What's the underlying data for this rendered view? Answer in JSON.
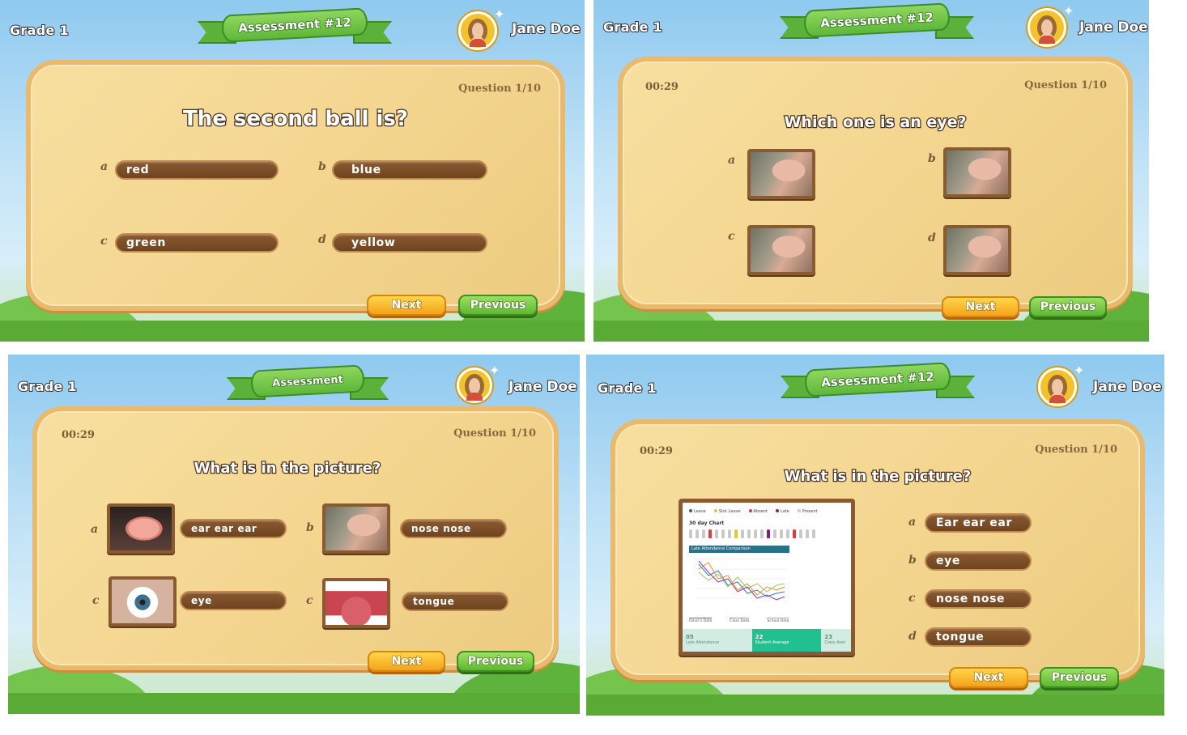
{
  "colors": {
    "next": "#f5a31a",
    "previous": "#5fb832",
    "answer_pill": "#6e4420",
    "board": "#f3d48d"
  },
  "panels": [
    {
      "grade": "Grade 1",
      "title": "Assessment #12",
      "user": "Jane Doe",
      "timer": "",
      "question_number": "Question 1/10",
      "question": "The second ball is?",
      "next": "Next",
      "previous": "Previous",
      "options": [
        {
          "letter": "a",
          "text": "red"
        },
        {
          "letter": "b",
          "text": "blue"
        },
        {
          "letter": "c",
          "text": "green"
        },
        {
          "letter": "d",
          "text": "yellow"
        }
      ]
    },
    {
      "grade": "Grade 1",
      "title": "Assessment #12",
      "user": "Jane Doe",
      "timer": "00:29",
      "question_number": "Question 1/10",
      "question": "Which one is an eye?",
      "next": "Next",
      "previous": "Previous",
      "options": [
        {
          "letter": "a",
          "image": "face-photo"
        },
        {
          "letter": "b",
          "image": "face-photo"
        },
        {
          "letter": "c",
          "image": "face-photo"
        },
        {
          "letter": "d",
          "image": "face-photo"
        }
      ]
    },
    {
      "grade": "Grade 1",
      "title": "Assessment",
      "user": "Jane Doe",
      "timer": "00:29",
      "question_number": "Question 1/10",
      "question": "What is in the picture?",
      "next": "Next",
      "previous": "Previous",
      "options": [
        {
          "letter": "a",
          "image": "ear-photo",
          "text": "ear ear ear"
        },
        {
          "letter": "b",
          "image": "face-photo",
          "text": "nose nose"
        },
        {
          "letter": "c",
          "image": "eye-photo",
          "text": "eye"
        },
        {
          "letter": "c",
          "image": "tongue-photo",
          "text": "tongue"
        }
      ]
    },
    {
      "grade": "Grade 1",
      "title": "Assessment #12",
      "user": "Jane Doe",
      "timer": "00:29",
      "question_number": "Question 1/10",
      "question": "What is in the picture?",
      "next": "Next",
      "previous": "Previous",
      "options": [
        {
          "letter": "a",
          "text": "Ear ear ear"
        },
        {
          "letter": "b",
          "text": "eye"
        },
        {
          "letter": "c",
          "text": "nose nose"
        },
        {
          "letter": "d",
          "text": "tongue"
        }
      ],
      "picture": {
        "legend": [
          "Leave",
          "Sick Leave",
          "Absent",
          "Late",
          "Present"
        ],
        "legend_colors": [
          "#2c5f8c",
          "#f2c12e",
          "#e03a3a",
          "#8a1f7a",
          "#c9c9c9"
        ],
        "title": "30 day Chart",
        "section": "Late Attendance Comparison",
        "series_labels": [
          "Omar's Data",
          "Class Data",
          "School Data"
        ],
        "stats": [
          {
            "value": "05",
            "label": "Late Attendance"
          },
          {
            "value": "22",
            "label": "Student Average"
          },
          {
            "value": "23",
            "label": "Class Aver"
          }
        ]
      }
    }
  ]
}
